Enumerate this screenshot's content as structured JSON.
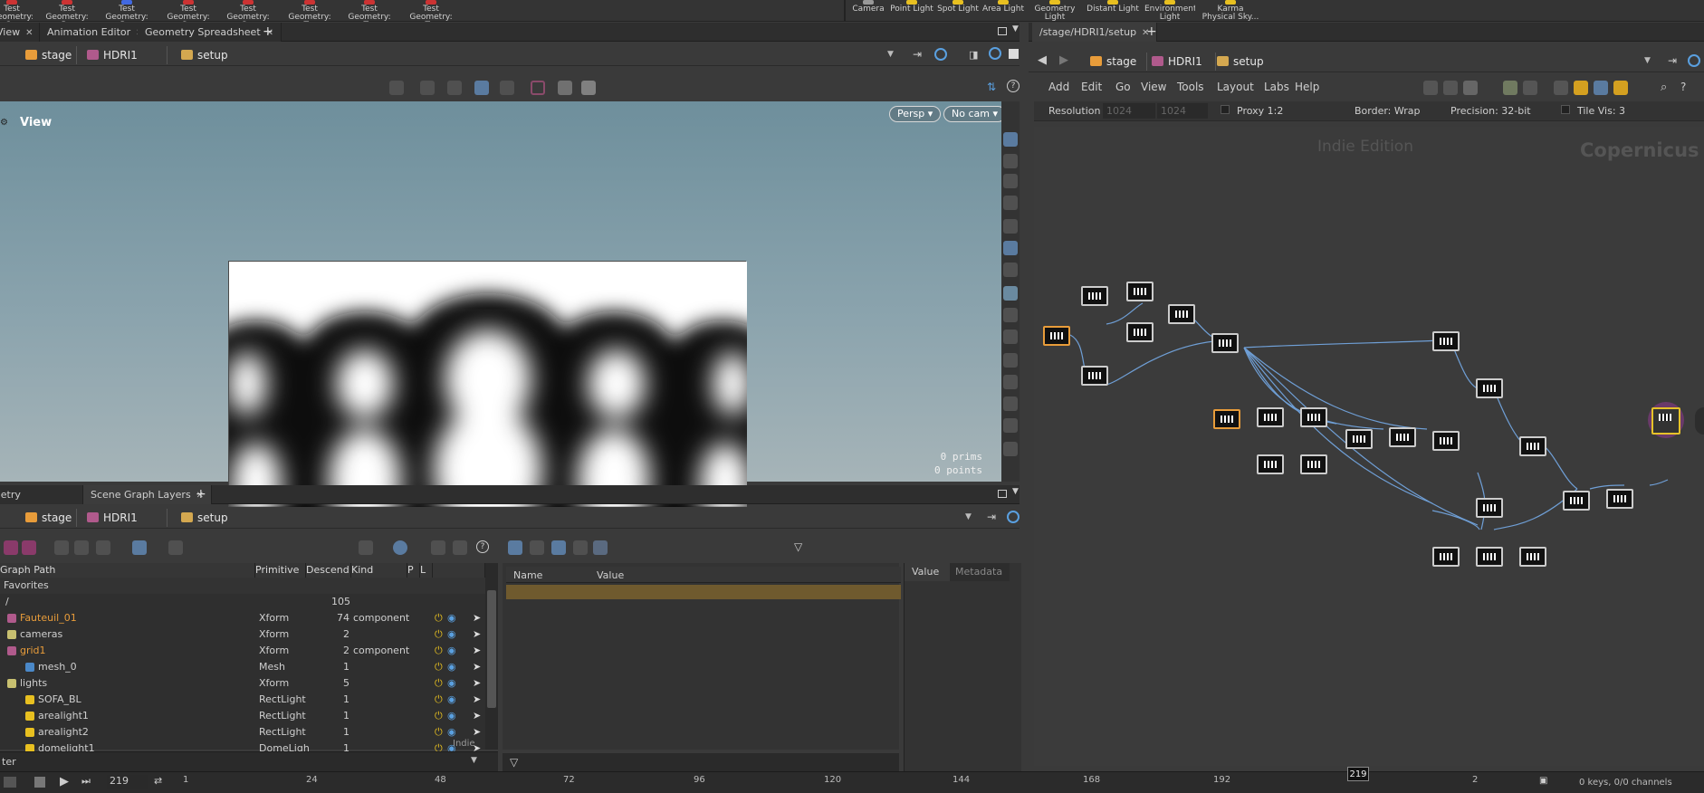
{
  "shelf": {
    "tools": [
      {
        "label": "Test Geometry: C...",
        "color": "#c33"
      },
      {
        "label": "Test Geometry: P...",
        "color": "#c33"
      },
      {
        "label": "Test Geometry: R...",
        "color": "#4169e1"
      },
      {
        "label": "Test Geometry: S...",
        "color": "#c33"
      },
      {
        "label": "Test Geometry: S...",
        "color": "#c33"
      },
      {
        "label": "Test Geometry: T...",
        "color": "#c33"
      },
      {
        "label": "Test Geometry: T...",
        "color": "#c33"
      },
      {
        "label": "Test Geometry: T...",
        "color": "#c33"
      }
    ],
    "lights": [
      {
        "label": "Camera"
      },
      {
        "label": "Point Light"
      },
      {
        "label": "Spot Light"
      },
      {
        "label": "Area Light"
      },
      {
        "label": "Geometry Light"
      },
      {
        "label": "Distant Light"
      },
      {
        "label": "Environment Light"
      },
      {
        "label": "Karma Physical Sky..."
      }
    ]
  },
  "left_tabs": [
    "View",
    "Animation Editor",
    "Geometry Spreadsheet"
  ],
  "path": {
    "stage": "stage",
    "hdri": "HDRI1",
    "setup": "setup"
  },
  "viewport": {
    "title": "View",
    "persp": "Persp ▾",
    "cam": "No cam ▾",
    "stats_prims": "0  prims",
    "stats_points": "0 points"
  },
  "bottom_tabs": [
    "Geometry Spreadsheet",
    "Scene Graph Layers"
  ],
  "tree": {
    "headers": {
      "path": "Graph Path",
      "primitive": "Primitive",
      "descend": "Descend",
      "kind": "Kind",
      "p": "P",
      "l": "L"
    },
    "favorites": "Favorites",
    "rows": [
      {
        "name": "/",
        "prim": "",
        "desc": "105",
        "kind": "",
        "orange": false
      },
      {
        "name": "Fauteuil_01",
        "prim": "Xform",
        "desc": "74",
        "kind": "component",
        "orange": true
      },
      {
        "name": "cameras",
        "prim": "Xform",
        "desc": "2",
        "kind": "",
        "orange": false
      },
      {
        "name": "grid1",
        "prim": "Xform",
        "desc": "2",
        "kind": "component",
        "orange": true
      },
      {
        "name": "mesh_0",
        "prim": "Mesh",
        "desc": "1",
        "kind": "",
        "orange": false
      },
      {
        "name": "lights",
        "prim": "Xform",
        "desc": "5",
        "kind": "",
        "orange": false
      },
      {
        "name": "SOFA_BL",
        "prim": "RectLight",
        "desc": "1",
        "kind": "",
        "orange": false
      },
      {
        "name": "arealight1",
        "prim": "RectLight",
        "desc": "1",
        "kind": "",
        "orange": false
      },
      {
        "name": "arealight2",
        "prim": "RectLight",
        "desc": "1",
        "kind": "",
        "orange": false
      },
      {
        "name": "domelight1",
        "prim": "DomeLigh",
        "desc": "1",
        "kind": "",
        "orange": false
      }
    ],
    "filter_label": "ter",
    "watermark": "Indie"
  },
  "params": {
    "name_header": "Name",
    "value_header": "Value",
    "value_tab": "Value",
    "metadata_tab": "Metadata"
  },
  "network": {
    "path_tab": "/stage/HDRI1/setup",
    "menu": [
      "Add",
      "Edit",
      "Go",
      "View",
      "Tools",
      "Layout",
      "Labs",
      "Help"
    ],
    "resolution_label": "Resolution",
    "res_w": "1024",
    "res_h": "1024",
    "proxy": "Proxy 1:2",
    "border": "Border: Wrap",
    "precision": "Precision: 32-bit",
    "tile_vis": "Tile Vis: 3",
    "edition": "Indie Edition",
    "context": "Copernicus"
  },
  "timeline": {
    "frame": "219",
    "ticks": [
      "1",
      "24",
      "48",
      "72",
      "96",
      "120",
      "144",
      "168",
      "192",
      "2"
    ],
    "keys": "0 keys, 0/0 channels"
  },
  "colors": {
    "accent_orange": "#e89c3a",
    "selected_node": "#e6c229",
    "wire": "#6f9fd6"
  }
}
